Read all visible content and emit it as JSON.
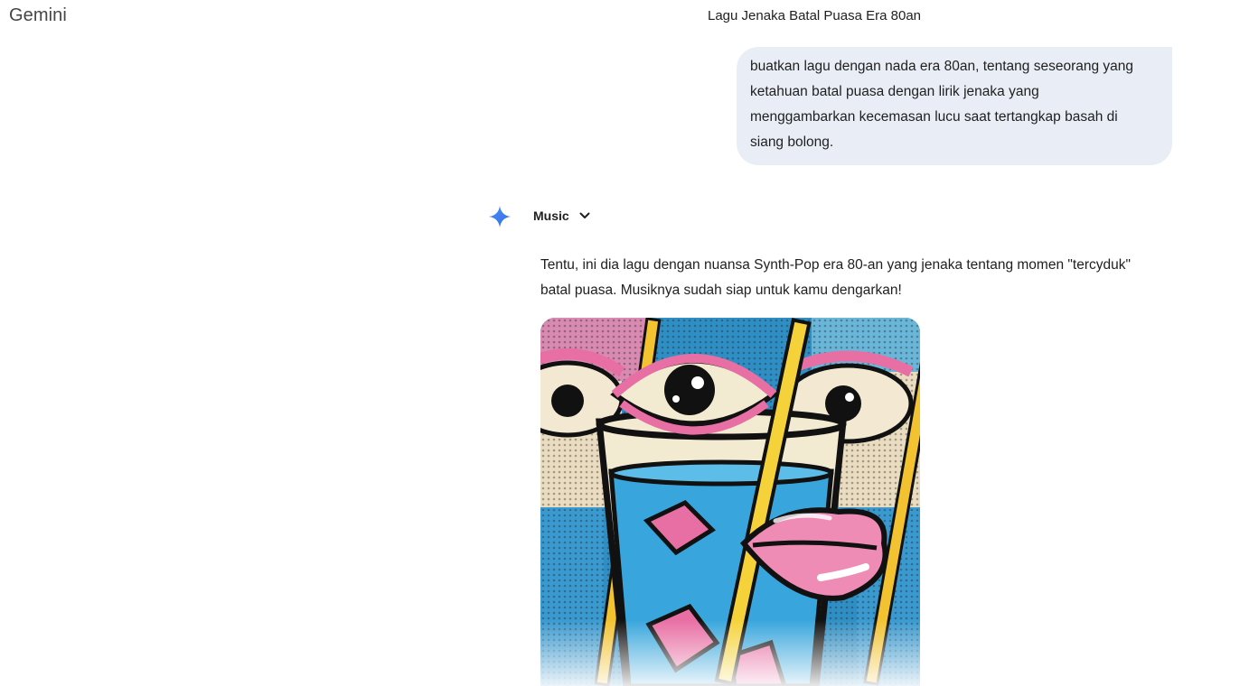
{
  "app": {
    "title": "Gemini"
  },
  "chat": {
    "title": "Lagu Jenaka Batal Puasa Era 80an"
  },
  "user_message": {
    "lines": [
      "buatkan lagu dengan nada era 80an, tentang seseorang yang",
      "ketahuan batal puasa dengan lirik jenaka yang",
      "menggambarkan kecemasan lucu saat tertangkap basah di",
      "siang bolong."
    ]
  },
  "response": {
    "model_label": "Music",
    "model_icon": "gemini-spark-icon",
    "dropdown_icon": "chevron-down-icon",
    "lines": [
      "Tentu, ini dia lagu dengan nuansa Synth-Pop era 80-an yang jenaka tentang momen \"tercyduk\"",
      "batal puasa. Musiknya sudah siap untuk kamu dengarkan!"
    ],
    "cover_image": "pop-art-cover-art"
  },
  "colors": {
    "bubble_bg": "#e9eef6",
    "spark_blue": "#4285f4",
    "text": "#1f1f1f"
  }
}
